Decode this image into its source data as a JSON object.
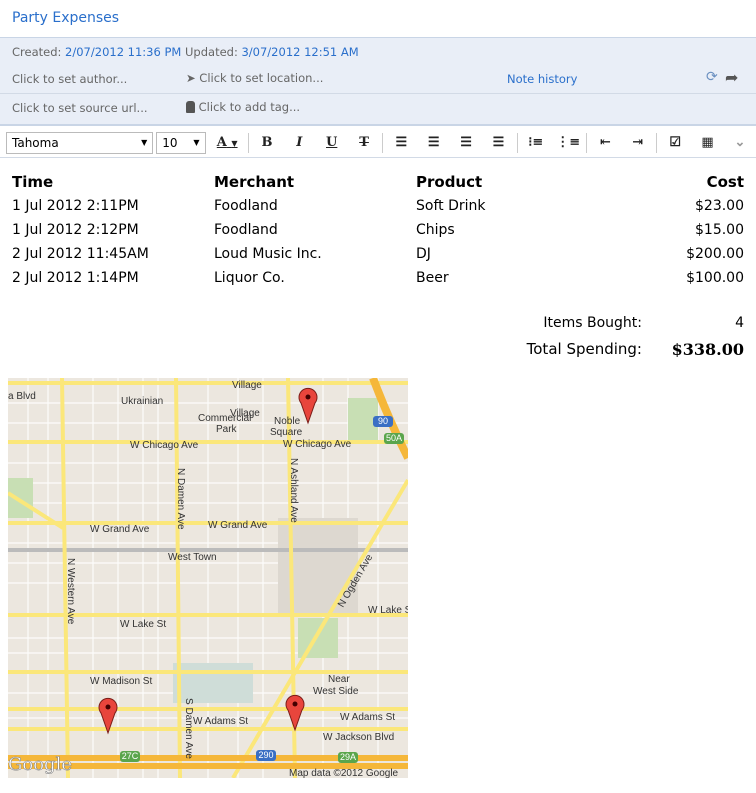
{
  "note": {
    "title": "Party Expenses"
  },
  "meta": {
    "created_label": "Created:",
    "created": "2/07/2012 11:36 PM",
    "updated_label": "Updated:",
    "updated": "3/07/2012 12:51 AM",
    "author": "Click to set author...",
    "location": "Click to set location...",
    "note_history": "Note history",
    "source_url": "Click to set source url...",
    "tag": "Click to add tag..."
  },
  "toolbar": {
    "font": "Tahoma",
    "size": "10",
    "bold": "B",
    "italic": "I",
    "underline": "U",
    "strike": "T",
    "color": "A"
  },
  "table": {
    "headers": [
      "Time",
      "Merchant",
      "Product",
      "Cost"
    ],
    "rows": [
      [
        "1 Jul 2012 2:11PM",
        "Foodland",
        "Soft Drink",
        "$23.00"
      ],
      [
        "1 Jul 2012 2:12PM",
        "Foodland",
        "Chips",
        "$15.00"
      ],
      [
        "2 Jul 2012 11:45AM",
        "Loud Music Inc.",
        "DJ",
        "$200.00"
      ],
      [
        "2 Jul 2012 1:14PM",
        "Liquor Co.",
        "Beer",
        "$100.00"
      ]
    ]
  },
  "summary": {
    "items_label": "Items Bought:",
    "items": "4",
    "total_label": "Total Spending:",
    "total": "$338.00"
  },
  "map": {
    "labels": [
      "Ukrainian",
      "Village",
      "Village",
      "Commercial",
      "Park",
      "Noble",
      "Square",
      "W Chicago Ave",
      "W Chicago Ave",
      "W Grand Ave",
      "W Grand Ave",
      "West Town",
      "W Lake St",
      "W Lake St",
      "W Madison St",
      "Near",
      "West Side",
      "W Adams St",
      "W Adams St",
      "W Jackson Blvd",
      "N Western Ave",
      "N Damen Ave",
      "N Ashland Ave",
      "N Ogden Ave",
      "S Damen Ave",
      "a Blvd"
    ],
    "shields": [
      "90",
      "50A",
      "290",
      "27C",
      "29A"
    ],
    "logo": "Google",
    "attribution": "Map data ©2012 Google"
  },
  "colors": {
    "accent": "#2a6fcb",
    "road": "#fbe77a",
    "highway": "#f5b73a",
    "pin": "#e8453c"
  }
}
